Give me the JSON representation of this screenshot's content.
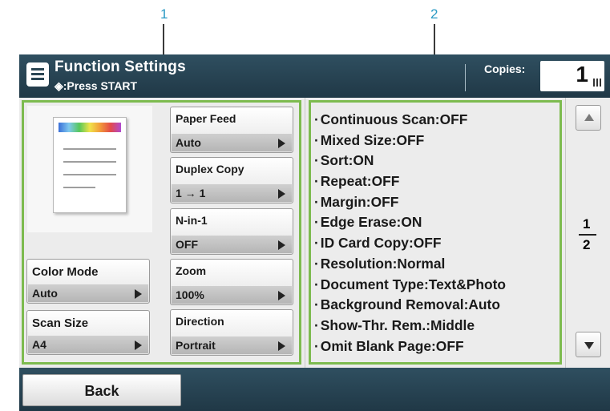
{
  "callouts": {
    "left": "1",
    "right": "2"
  },
  "header": {
    "title": "Function Settings",
    "subtitle": "◈:Press START",
    "copies_label": "Copies:",
    "copies_value": "1"
  },
  "left_panel": {
    "color_mode": {
      "label": "Color Mode",
      "value": "Auto"
    },
    "scan_size": {
      "label": "Scan Size",
      "value": "A4"
    }
  },
  "mid_panel": [
    {
      "label": "Paper Feed",
      "value": "Auto"
    },
    {
      "label": "Duplex Copy",
      "value": "1 → 1"
    },
    {
      "label": "N-in-1",
      "value": "OFF"
    },
    {
      "label": "Zoom",
      "value": "100%"
    },
    {
      "label": "Direction",
      "value": "Portrait"
    }
  ],
  "settings": [
    "Continuous Scan:OFF",
    "Mixed Size:OFF",
    "Sort:ON",
    "Repeat:OFF",
    "Margin:OFF",
    "Edge Erase:ON",
    "ID Card Copy:OFF",
    "Resolution:Normal",
    "Document Type:Text&Photo",
    "Background Removal:Auto",
    "Show-Thr. Rem.:Middle",
    "Omit Blank Page:OFF"
  ],
  "pager": {
    "current": "1",
    "total": "2"
  },
  "footer": {
    "back_label": "Back"
  },
  "colors": {
    "header_bg": "#2b4654",
    "highlight_border": "#7dbb4f",
    "callout": "#2a9ac4"
  },
  "icons": {
    "menu": "menu-icon",
    "start": "start-diamond-icon",
    "keypad": "keypad-icon",
    "up": "up-arrow-icon",
    "down": "down-arrow-icon"
  }
}
